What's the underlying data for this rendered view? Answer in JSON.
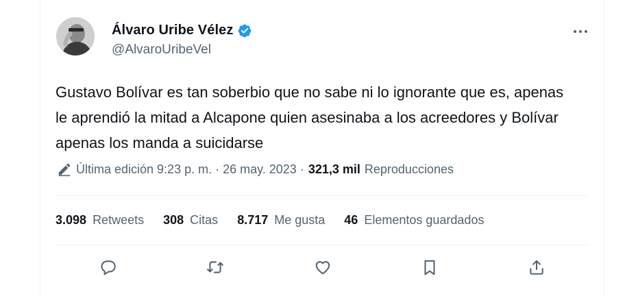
{
  "tweet": {
    "author_name": "Álvaro Uribe Vélez",
    "handle": "@AlvaroUribeVel",
    "text": "Gustavo Bolívar es tan soberbio que no sabe ni lo ignorante que es, apenas le aprendió la mitad a Alcapone quien asesinaba a los acreedores y Bolívar apenas los manda a suicidarse",
    "edited_label": "Última edición 9:23 p. m. · 26 may. 2023 ·",
    "views_count": "321,3 mil",
    "views_label": "Reproducciones"
  },
  "stats": {
    "retweets": {
      "count": "3.098",
      "label": "Retweets"
    },
    "quotes": {
      "count": "308",
      "label": "Citas"
    },
    "likes": {
      "count": "8.717",
      "label": "Me gusta"
    },
    "bookmarks": {
      "count": "46",
      "label": "Elementos guardados"
    }
  },
  "colors": {
    "text": "#0f1419",
    "secondary": "#536471",
    "verified": "#1d9bf0",
    "divider": "#eff3f4"
  },
  "icons": [
    "verified-badge-icon",
    "more-icon",
    "edit-pencil-icon",
    "reply-icon",
    "retweet-icon",
    "like-icon",
    "bookmark-icon",
    "share-icon"
  ]
}
